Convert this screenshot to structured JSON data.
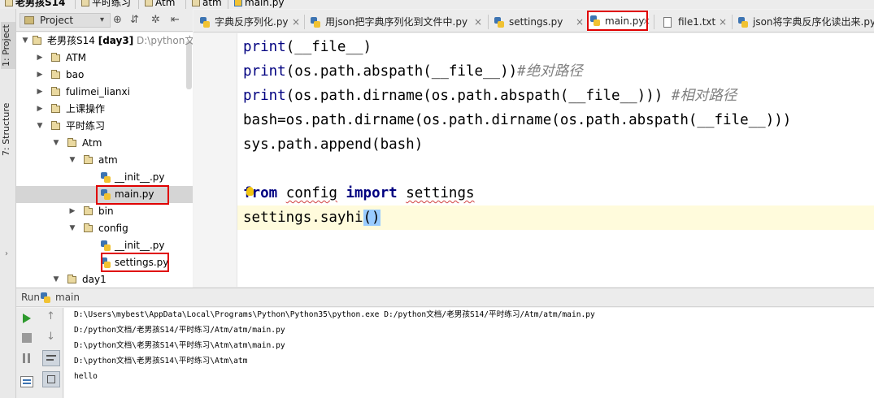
{
  "breadcrumb": {
    "items": [
      "老男孩S14",
      "平时练习",
      "Atm",
      "atm",
      "main.py"
    ]
  },
  "left_strip": {
    "project_tab": "1: Project",
    "structure_tab": "7: Structure"
  },
  "project_panel": {
    "title": "Project",
    "tree": [
      {
        "label": "老男孩S14",
        "meta": "[day3]",
        "path": "D:\\python文"
      },
      {
        "label": "ATM"
      },
      {
        "label": "bao"
      },
      {
        "label": "fulimei_lianxi"
      },
      {
        "label": "上课操作"
      },
      {
        "label": "平时练习"
      },
      {
        "label": "Atm"
      },
      {
        "label": "atm"
      },
      {
        "label": "__init__.py"
      },
      {
        "label": "main.py"
      },
      {
        "label": "bin"
      },
      {
        "label": "config"
      },
      {
        "label": "__init__.py"
      },
      {
        "label": "settings.py"
      },
      {
        "label": "day1"
      }
    ]
  },
  "tabs": [
    {
      "label": "字典反序列化.py"
    },
    {
      "label": "用json把字典序列化到文件中.py"
    },
    {
      "label": "settings.py"
    },
    {
      "label": "main.py"
    },
    {
      "label": "file1.txt"
    },
    {
      "label": "json将字典反序化读出来.py"
    }
  ],
  "editor": {
    "lines": {
      "l1_fn": "print",
      "l1_rest": "(__file__)",
      "l2_fn": "print",
      "l2_rest": "(os.path.abspath(__file__))",
      "l2_comment": "#绝对路径",
      "l3_fn": "print",
      "l3_rest": "(os.path.dirname(os.path.abspath(__file__))) ",
      "l3_comment": "#相对路径",
      "l4": "bash=os.path.dirname(os.path.dirname(os.path.abspath(__file__)))",
      "l5": "sys.path.append(bash)",
      "l6_kw1": "from",
      "l6_mod": "config",
      "l6_kw2": "import",
      "l6_name": "settings",
      "l7_a": "settings.",
      "l7_fn": "sayhi",
      "l7_paren": "()"
    }
  },
  "run_panel": {
    "label": "Run",
    "config": "main",
    "output": [
      "D:\\Users\\mybest\\AppData\\Local\\Programs\\Python\\Python35\\python.exe D:/python文档/老男孩S14/平时练习/Atm/atm/main.py",
      "D:/python文档/老男孩S14/平时练习/Atm/atm/main.py",
      "D:\\python文档\\老男孩S14\\平时练习\\Atm\\atm\\main.py",
      "D:\\python文档\\老男孩S14\\平时练习\\Atm\\atm",
      "hello"
    ]
  },
  "colors": {
    "highlight_box": "#e00000",
    "keyword": "#000080",
    "comment": "#808080",
    "run_green": "#2e9a2e"
  }
}
